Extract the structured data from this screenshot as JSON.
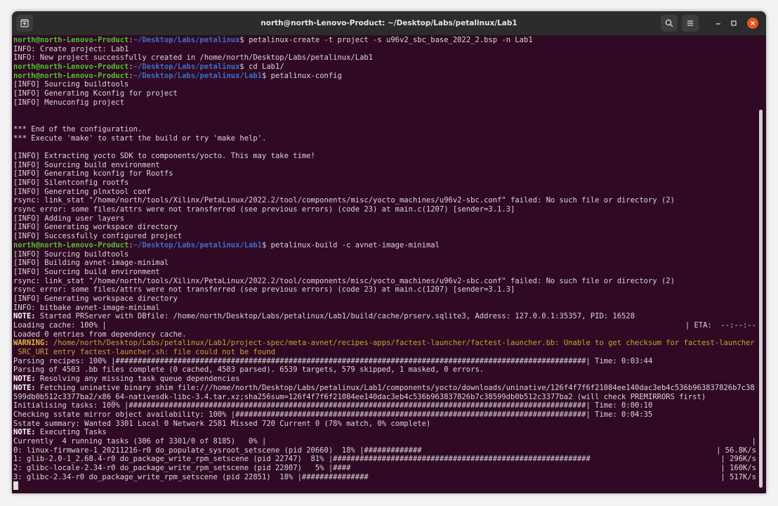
{
  "window": {
    "title": "north@north-Lenovo-Product: ~/Desktop/Labs/petalinux/Lab1",
    "colors": {
      "background": "#300a24",
      "user": "#4ec42a",
      "path": "#3f6ec6",
      "warning": "#c9a230",
      "close": "#e95420"
    },
    "icons": [
      "new-tab-icon",
      "search-icon",
      "hamburger-menu-icon",
      "minimize-icon",
      "maximize-icon",
      "close-icon"
    ]
  },
  "lines": [
    {
      "user": "north@north-Lenovo-Product",
      "path": "~/Desktop/Labs/petalinux",
      "cmd": "$ petalinux-create -t project -s u96v2_sbc_base_2022_2.bsp -n Lab1"
    },
    {
      "text": "INFO: Create project: Lab1"
    },
    {
      "text": "INFO: New project successfully created in /home/north/Desktop/Labs/petalinux/Lab1"
    },
    {
      "user": "north@north-Lenovo-Product",
      "path": "~/Desktop/Labs/petalinux",
      "cmd": "$ cd Lab1/"
    },
    {
      "user": "north@north-Lenovo-Product",
      "path": "~/Desktop/Labs/petalinux/Lab1",
      "cmd": "$ petalinux-config"
    },
    {
      "text": "[INFO] Sourcing buildtools"
    },
    {
      "text": "[INFO] Generating Kconfig for project"
    },
    {
      "text": "[INFO] Menuconfig project"
    },
    {
      "text": ""
    },
    {
      "text": ""
    },
    {
      "text": "*** End of the configuration."
    },
    {
      "text": "*** Execute 'make' to start the build or try 'make help'."
    },
    {
      "text": ""
    },
    {
      "text": "[INFO] Extracting yocto SDK to components/yocto. This may take time!"
    },
    {
      "text": "[INFO] Sourcing build environment"
    },
    {
      "text": "[INFO] Generating kconfig for Rootfs"
    },
    {
      "text": "[INFO] Silentconfig rootfs"
    },
    {
      "text": "[INFO] Generating plnxtool conf"
    },
    {
      "text": "rsync: link_stat \"/home/north/tools/Xilinx/PetaLinux/2022.2/tool/components/misc/yocto_machines/u96v2-sbc.conf\" failed: No such file or directory (2)"
    },
    {
      "text": "rsync error: some files/attrs were not transferred (see previous errors) (code 23) at main.c(1207) [sender=3.1.3]"
    },
    {
      "text": "[INFO] Adding user layers"
    },
    {
      "text": "[INFO] Generating workspace directory"
    },
    {
      "text": "[INFO] Successfully configured project"
    },
    {
      "user": "north@north-Lenovo-Product",
      "path": "~/Desktop/Labs/petalinux/Lab1",
      "cmd": "$ petalinux-build -c avnet-image-minimal"
    },
    {
      "text": "[INFO] Sourcing buildtools"
    },
    {
      "text": "[INFO] Building avnet-image-minimal"
    },
    {
      "text": "[INFO] Sourcing build environment"
    },
    {
      "text": "rsync: link_stat \"/home/north/tools/Xilinx/PetaLinux/2022.2/tool/components/misc/yocto_machines/u96v2-sbc.conf\" failed: No such file or directory (2)"
    },
    {
      "text": "rsync error: some files/attrs were not transferred (see previous errors) (code 23) at main.c(1207) [sender=3.1.3]"
    },
    {
      "text": "[INFO] Generating workspace directory"
    },
    {
      "text": "INFO: bitbake avnet-image-minimal"
    },
    {
      "label": "NOTE:",
      "text": " Started PRServer with DBfile: /home/north/Desktop/Labs/petalinux/Lab1/build/cache/prserv.sqlite3, Address: 127.0.0.1:35357, PID: 16528"
    },
    {
      "text": "Loading cache: 100% |",
      "right": "| ETA:  --:--:--"
    },
    {
      "text": "Loaded 0 entries from dependency cache."
    },
    {
      "warn": "WARNING:",
      "text": " /home/north/Desktop/Labs/petalinux/Lab1/project-spec/meta-avnet/recipes-apps/factest-launcher/factest-launcher.bb: Unable to get checksum for factest-launcher"
    },
    {
      "warntext": " SRC_URI entry factest-launcher.sh: file could not be found"
    },
    {
      "text": "Parsing recipes: 100% |##########################################################################################################| Time: 0:03:44"
    },
    {
      "text": "Parsing of 4503 .bb files complete (0 cached, 4503 parsed). 6539 targets, 579 skipped, 1 masked, 0 errors."
    },
    {
      "label": "NOTE:",
      "text": " Resolving any missing task queue dependencies"
    },
    {
      "label": "NOTE:",
      "text": " Fetching uninative binary shim file:///home/north/Desktop/Labs/petalinux/Lab1/components/yocto/downloads/uninative/126f4f7f6f21084ee140dac3eb4c536b963837826b7c38"
    },
    {
      "text": "599db0b512c3377ba2/x86_64-nativesdk-libc-3.4.tar.xz;sha256sum=126f4f7f6f21084ee140dac3eb4c536b963837826b7c38599db0b512c3377ba2 (will check PREMIRRORS first)"
    },
    {
      "text": "Initialising tasks: 100% |#######################################################################################################| Time: 0:00:10"
    },
    {
      "text": "Checking sstate mirror object availability: 100% |###############################################################################| Time: 0:04:35"
    },
    {
      "text": "Sstate summary: Wanted 3301 Local 0 Network 2581 Missed 720 Current 0 (78% match, 0% complete)"
    },
    {
      "label": "NOTE:",
      "text": " Executing Tasks"
    },
    {
      "text": "Currently  4 running tasks (306 of 3301/0 of 8185)   0% |",
      "right": "|"
    },
    {
      "text": "0: linux-firmware-1_20211216-r0 do_populate_sysroot_setscene (pid 20660)  18% |#############",
      "right": "| 56.8K/s"
    },
    {
      "text": "1: glib-2.0-1_2.68.4-r0 do_package_write_rpm_setscene (pid 22747)  81% |##########################################################",
      "right": "| 296K/s"
    },
    {
      "text": "2: glibc-locale-2.34-r0 do_package_write_rpm_setscene (pid 22807)   5% |####",
      "right": "| 160K/s"
    },
    {
      "text": "3: glibc-2.34-r0 do_package_write_rpm_setscene (pid 22851)  18% |###############",
      "right": "| 517K/s"
    }
  ]
}
